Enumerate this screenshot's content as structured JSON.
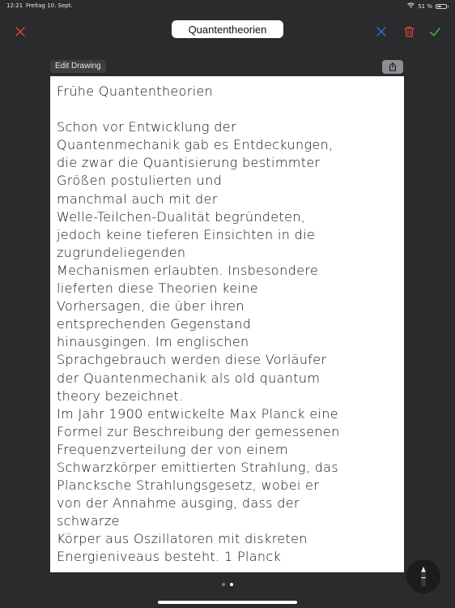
{
  "status_bar": {
    "time": "12:21",
    "date": "Freitag 10. Sept.",
    "battery_text": "51 %",
    "battery_level": 0.51,
    "icons": [
      "wifi-icon",
      "battery-icon"
    ]
  },
  "toolbar": {
    "title": "Quantentheorien",
    "icons": [
      "close-icon",
      "eraser-icon",
      "trash-icon",
      "checkmark-icon"
    ],
    "colors": {
      "accent_red": "#e0453a",
      "accent_blue": "#2f6fe8",
      "accent_green": "#38b34a"
    }
  },
  "canvas_toolbar": {
    "edit_label": "Edit Drawing",
    "share_icon": "share-icon"
  },
  "drawing": {
    "heading": "Frühe Quantentheorien",
    "lines": [
      "Schon vor Entwicklung der",
      "Quantenmechanik gab es Entdeckungen,",
      "die zwar die Quantisierung bestimmter",
      "Größen postulierten und",
      "manchmal auch mit der",
      "Welle-Teilchen-Dualität begründeten,",
      "jedoch keine tieferen Einsichten in die",
      "zugrundeliegenden",
      "Mechanismen erlaubten. Insbesondere",
      "lieferten diese Theorien keine",
      "Vorhersagen, die über ihren",
      "entsprechenden Gegenstand",
      "hinausgingen. Im englischen",
      "Sprachgebrauch werden diese Vorläufer",
      "der Quantenmechanik als old quantum",
      "theory bezeichnet.",
      "Im Jahr 1900 entwickelte Max Planck eine",
      "Formel zur Beschreibung der gemessenen",
      "Frequenzverteilung der von einem",
      "Schwarzkörper emittierten Strahlung, das",
      "Plancksche Strahlungsgesetz, wobei er",
      "von der Annahme ausging, dass der",
      "schwarze",
      "Körper aus Oszillatoren mit diskreten",
      "Energieniveaus besteht. 1 Planck"
    ]
  },
  "pagination": {
    "pages": 2,
    "current": 2
  },
  "tool": {
    "icon": "pencil-icon"
  }
}
